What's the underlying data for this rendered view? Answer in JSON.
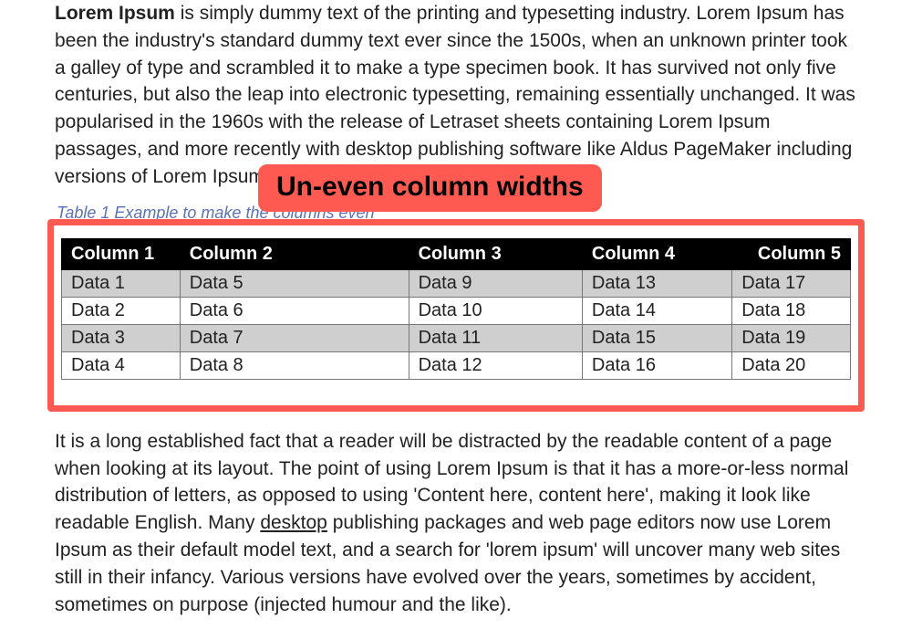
{
  "para1": {
    "lead": "Lorem Ipsum",
    "rest": " is simply dummy text of the printing and typesetting industry. Lorem Ipsum has been the industry's standard dummy text ever since the 1500s, when an unknown printer took a galley of type and scrambled it to make a type specimen book. It has survived not only five centuries, but also the leap into electronic typesetting, remaining essentially unchanged. It was popularised in the 1960s with the release of Letraset sheets containing Lorem Ipsum passages, and more recently with desktop publishing software like Aldus PageMaker including versions of Lorem Ipsum."
  },
  "callout": "Un-even column widths",
  "caption": "Table 1 Example to make the columns even",
  "table": {
    "headers": [
      "Column 1",
      "Column 2",
      "Column 3",
      "Column 4",
      "Column 5"
    ],
    "rows": [
      [
        "Data 1",
        "Data 5",
        "Data 9",
        "Data 13",
        "Data 17"
      ],
      [
        "Data 2",
        "Data 6",
        "Data 10",
        "Data 14",
        "Data 18"
      ],
      [
        "Data 3",
        "Data 7",
        "Data 11",
        "Data 15",
        "Data 19"
      ],
      [
        "Data 4",
        "Data 8",
        "Data 12",
        "Data 16",
        "Data 20"
      ]
    ]
  },
  "para2": {
    "before": "It is a long established fact that a reader will be distracted by the readable content of a page when looking at its layout. The point of using Lorem Ipsum is that it has a more-or-less normal distribution of letters, as opposed to using 'Content here, content here', making it look like readable English. Many ",
    "link": "desktop",
    "after": " publishing packages and web page editors now use Lorem Ipsum as their default model text, and a search for 'lorem ipsum' will uncover many web sites still in their infancy. Various versions have evolved over the years, sometimes by accident, sometimes on purpose (injected humour and the like)."
  }
}
